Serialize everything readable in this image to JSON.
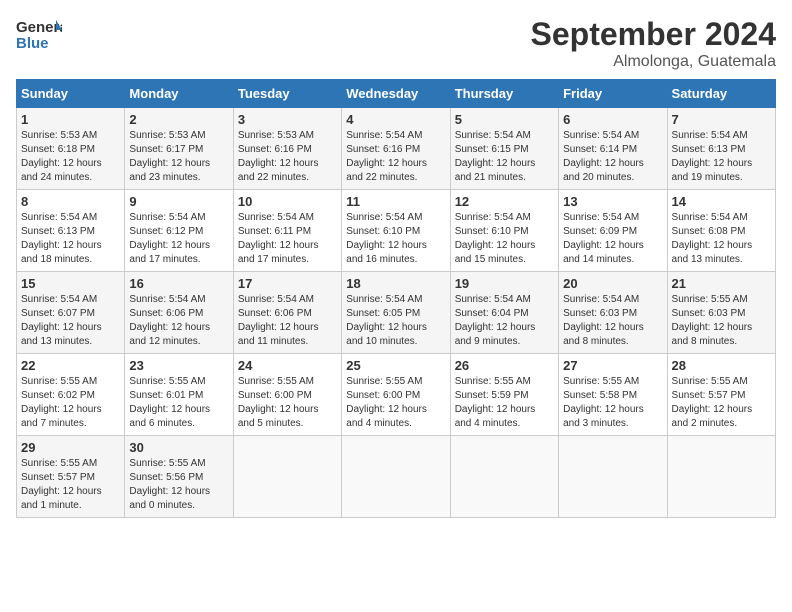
{
  "logo": {
    "text_general": "General",
    "text_blue": "Blue"
  },
  "title": "September 2024",
  "location": "Almolonga, Guatemala",
  "weekdays": [
    "Sunday",
    "Monday",
    "Tuesday",
    "Wednesday",
    "Thursday",
    "Friday",
    "Saturday"
  ],
  "weeks": [
    [
      {
        "day": "1",
        "sunrise": "5:53 AM",
        "sunset": "6:18 PM",
        "daylight": "12 hours and 24 minutes."
      },
      {
        "day": "2",
        "sunrise": "5:53 AM",
        "sunset": "6:17 PM",
        "daylight": "12 hours and 23 minutes."
      },
      {
        "day": "3",
        "sunrise": "5:53 AM",
        "sunset": "6:16 PM",
        "daylight": "12 hours and 22 minutes."
      },
      {
        "day": "4",
        "sunrise": "5:54 AM",
        "sunset": "6:16 PM",
        "daylight": "12 hours and 22 minutes."
      },
      {
        "day": "5",
        "sunrise": "5:54 AM",
        "sunset": "6:15 PM",
        "daylight": "12 hours and 21 minutes."
      },
      {
        "day": "6",
        "sunrise": "5:54 AM",
        "sunset": "6:14 PM",
        "daylight": "12 hours and 20 minutes."
      },
      {
        "day": "7",
        "sunrise": "5:54 AM",
        "sunset": "6:13 PM",
        "daylight": "12 hours and 19 minutes."
      }
    ],
    [
      {
        "day": "8",
        "sunrise": "5:54 AM",
        "sunset": "6:13 PM",
        "daylight": "12 hours and 18 minutes."
      },
      {
        "day": "9",
        "sunrise": "5:54 AM",
        "sunset": "6:12 PM",
        "daylight": "12 hours and 17 minutes."
      },
      {
        "day": "10",
        "sunrise": "5:54 AM",
        "sunset": "6:11 PM",
        "daylight": "12 hours and 17 minutes."
      },
      {
        "day": "11",
        "sunrise": "5:54 AM",
        "sunset": "6:10 PM",
        "daylight": "12 hours and 16 minutes."
      },
      {
        "day": "12",
        "sunrise": "5:54 AM",
        "sunset": "6:10 PM",
        "daylight": "12 hours and 15 minutes."
      },
      {
        "day": "13",
        "sunrise": "5:54 AM",
        "sunset": "6:09 PM",
        "daylight": "12 hours and 14 minutes."
      },
      {
        "day": "14",
        "sunrise": "5:54 AM",
        "sunset": "6:08 PM",
        "daylight": "12 hours and 13 minutes."
      }
    ],
    [
      {
        "day": "15",
        "sunrise": "5:54 AM",
        "sunset": "6:07 PM",
        "daylight": "12 hours and 13 minutes."
      },
      {
        "day": "16",
        "sunrise": "5:54 AM",
        "sunset": "6:06 PM",
        "daylight": "12 hours and 12 minutes."
      },
      {
        "day": "17",
        "sunrise": "5:54 AM",
        "sunset": "6:06 PM",
        "daylight": "12 hours and 11 minutes."
      },
      {
        "day": "18",
        "sunrise": "5:54 AM",
        "sunset": "6:05 PM",
        "daylight": "12 hours and 10 minutes."
      },
      {
        "day": "19",
        "sunrise": "5:54 AM",
        "sunset": "6:04 PM",
        "daylight": "12 hours and 9 minutes."
      },
      {
        "day": "20",
        "sunrise": "5:54 AM",
        "sunset": "6:03 PM",
        "daylight": "12 hours and 8 minutes."
      },
      {
        "day": "21",
        "sunrise": "5:55 AM",
        "sunset": "6:03 PM",
        "daylight": "12 hours and 8 minutes."
      }
    ],
    [
      {
        "day": "22",
        "sunrise": "5:55 AM",
        "sunset": "6:02 PM",
        "daylight": "12 hours and 7 minutes."
      },
      {
        "day": "23",
        "sunrise": "5:55 AM",
        "sunset": "6:01 PM",
        "daylight": "12 hours and 6 minutes."
      },
      {
        "day": "24",
        "sunrise": "5:55 AM",
        "sunset": "6:00 PM",
        "daylight": "12 hours and 5 minutes."
      },
      {
        "day": "25",
        "sunrise": "5:55 AM",
        "sunset": "6:00 PM",
        "daylight": "12 hours and 4 minutes."
      },
      {
        "day": "26",
        "sunrise": "5:55 AM",
        "sunset": "5:59 PM",
        "daylight": "12 hours and 4 minutes."
      },
      {
        "day": "27",
        "sunrise": "5:55 AM",
        "sunset": "5:58 PM",
        "daylight": "12 hours and 3 minutes."
      },
      {
        "day": "28",
        "sunrise": "5:55 AM",
        "sunset": "5:57 PM",
        "daylight": "12 hours and 2 minutes."
      }
    ],
    [
      {
        "day": "29",
        "sunrise": "5:55 AM",
        "sunset": "5:57 PM",
        "daylight": "12 hours and 1 minute."
      },
      {
        "day": "30",
        "sunrise": "5:55 AM",
        "sunset": "5:56 PM",
        "daylight": "12 hours and 0 minutes."
      },
      null,
      null,
      null,
      null,
      null
    ]
  ]
}
